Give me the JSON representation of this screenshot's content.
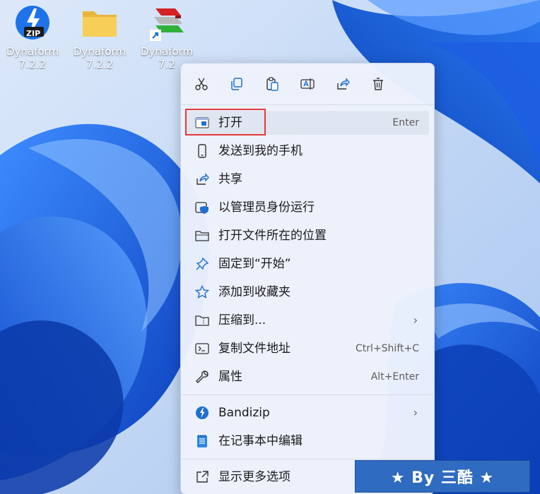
{
  "desktop": {
    "icons": [
      {
        "label_line1": "Dynaform",
        "label_line2": "7.2.2",
        "icon": "zip-archive-icon",
        "badge": "ZIP"
      },
      {
        "label_line1": "Dynaform",
        "label_line2": "7.2.2",
        "icon": "folder-icon"
      },
      {
        "label_line1": "Dynaform",
        "label_line2": "7.2",
        "icon": "app-shortcut-icon"
      }
    ]
  },
  "context_menu": {
    "toolbar": [
      {
        "name": "cut",
        "icon": "scissors-icon"
      },
      {
        "name": "copy",
        "icon": "copy-icon"
      },
      {
        "name": "paste",
        "icon": "clipboard-icon"
      },
      {
        "name": "rename",
        "icon": "rename-icon"
      },
      {
        "name": "share",
        "icon": "share-icon"
      },
      {
        "name": "delete",
        "icon": "trash-icon"
      }
    ],
    "items": [
      {
        "label": "打开",
        "shortcut": "Enter",
        "icon": "open-window-icon",
        "selected": true
      },
      {
        "label": "发送到我的手机",
        "shortcut": "",
        "icon": "phone-icon"
      },
      {
        "label": "共享",
        "shortcut": "",
        "icon": "share-icon"
      },
      {
        "label": "以管理员身份运行",
        "shortcut": "",
        "icon": "admin-shield-icon"
      },
      {
        "label": "打开文件所在的位置",
        "shortcut": "",
        "icon": "folder-icon"
      },
      {
        "label": "固定到“开始”",
        "shortcut": "",
        "icon": "pin-icon"
      },
      {
        "label": "添加到收藏夹",
        "shortcut": "",
        "icon": "star-icon"
      },
      {
        "label": "压缩到...",
        "shortcut": "",
        "icon": "zip-folder-icon",
        "submenu": true
      },
      {
        "label": "复制文件地址",
        "shortcut": "Ctrl+Shift+C",
        "icon": "copy-path-icon"
      },
      {
        "label": "属性",
        "shortcut": "Alt+Enter",
        "icon": "wrench-icon"
      },
      {
        "label": "Bandizip",
        "shortcut": "",
        "icon": "bandizip-icon",
        "submenu": true
      },
      {
        "label": "在记事本中编辑",
        "shortcut": "",
        "icon": "notepad-icon"
      },
      {
        "label": "显示更多选项",
        "shortcut": "",
        "icon": "more-options-icon"
      }
    ],
    "submenu_glyph": "›"
  },
  "watermark": {
    "text": "★ By 三酷 ★"
  },
  "colors": {
    "accent": "#1f6fd1",
    "highlight": "#e63a3a",
    "watermark_bg": "#2f6bc0"
  }
}
